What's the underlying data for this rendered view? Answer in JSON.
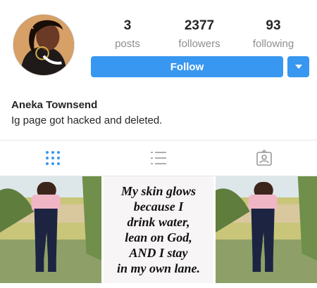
{
  "profile": {
    "name": "Aneka Townsend",
    "bio": "Ig page got hacked and deleted."
  },
  "stats": {
    "posts": {
      "count": "3",
      "label": "posts"
    },
    "followers": {
      "count": "2377",
      "label": "followers"
    },
    "following": {
      "count": "93",
      "label": "following"
    }
  },
  "actions": {
    "follow_label": "Follow"
  },
  "tabs": [
    {
      "icon": "grid-icon",
      "active": true
    },
    {
      "icon": "list-icon",
      "active": false
    },
    {
      "icon": "tagged-icon",
      "active": false
    }
  ],
  "posts": [
    {
      "type": "photo"
    },
    {
      "type": "quote",
      "text": "My skin glows\nbecause I\ndrink water,\nlean on God,\nAND I stay\nin my own lane."
    },
    {
      "type": "photo"
    }
  ],
  "colors": {
    "accent": "#3897f0",
    "active_tab": "#3897f0",
    "inactive_tab": "#999999"
  }
}
